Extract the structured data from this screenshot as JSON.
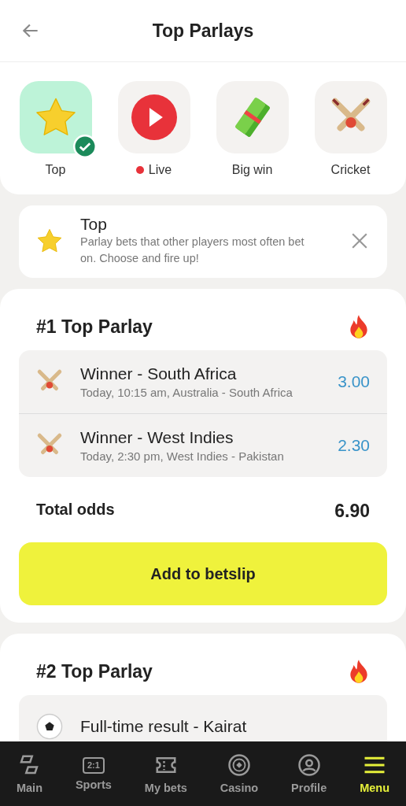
{
  "header": {
    "title": "Top Parlays"
  },
  "categories": [
    {
      "label": "Top",
      "kind": "star",
      "selected": true,
      "live": false
    },
    {
      "label": "Live",
      "kind": "play",
      "selected": false,
      "live": true
    },
    {
      "label": "Big win",
      "kind": "money",
      "selected": false,
      "live": false
    },
    {
      "label": "Cricket",
      "kind": "cricket",
      "selected": false,
      "live": false
    }
  ],
  "info": {
    "title": "Top",
    "text": "Parlay bets that other players most often bet on. Choose and fire up!"
  },
  "parlays": [
    {
      "title": "#1 Top Parlay",
      "bets": [
        {
          "kind": "cricket",
          "market": "Winner - South Africa",
          "details": "Today, 10:15 am, Australia - South Africa",
          "odds": "3.00"
        },
        {
          "kind": "cricket",
          "market": "Winner - West Indies",
          "details": "Today, 2:30 pm, West Indies - Pakistan",
          "odds": "2.30"
        }
      ],
      "total_label": "Total odds",
      "total": "6.90",
      "button": "Add to betslip"
    },
    {
      "title": "#2 Top Parlay",
      "bets": [
        {
          "kind": "soccer",
          "market": "Full-time result - Kairat"
        }
      ]
    }
  ],
  "nav": [
    {
      "label": "Main",
      "kind": "main",
      "selected": false
    },
    {
      "label": "Sports",
      "kind": "score",
      "icon_text": "2:1",
      "selected": false
    },
    {
      "label": "My bets",
      "kind": "ticket",
      "selected": false
    },
    {
      "label": "Casino",
      "kind": "chip",
      "selected": false
    },
    {
      "label": "Profile",
      "kind": "profile",
      "selected": false
    },
    {
      "label": "Menu",
      "kind": "menu",
      "selected": true
    }
  ]
}
